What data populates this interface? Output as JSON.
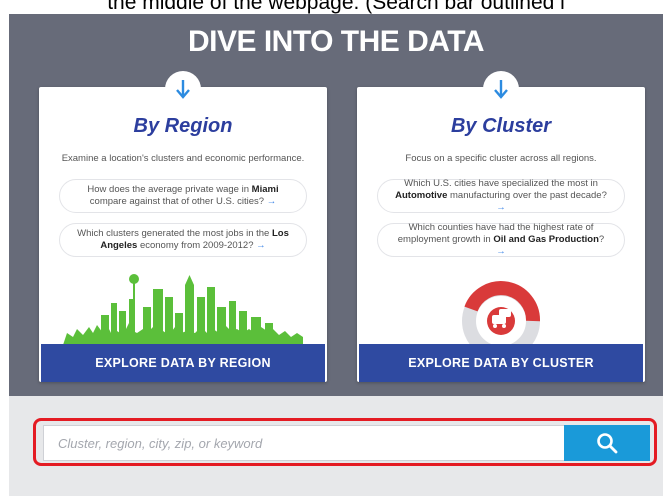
{
  "instruction": "the middle of the webpage. (Search bar outlined i",
  "hero": {
    "title": "DIVE INTO THE DATA"
  },
  "region": {
    "title": "By Region",
    "desc": "Examine a location's clusters and economic performance.",
    "q1": {
      "pre": "How does the average private wage in ",
      "bold": "Miami",
      "post": " compare against that of other U.S. cities? ",
      "arrow": "→"
    },
    "q2": {
      "pre": "Which clusters generated the most jobs in the ",
      "bold": "Los Angeles",
      "post": " economy from 2009-2012? ",
      "arrow": "→"
    },
    "button": "EXPLORE DATA BY REGION"
  },
  "cluster": {
    "title": "By Cluster",
    "desc": "Focus on a specific cluster across all regions.",
    "q1": {
      "pre": "Which U.S. cities have specialized the most in ",
      "bold": "Automotive",
      "post": " manufacturing over the past decade? ",
      "arrow": "→"
    },
    "q2": {
      "pre": "Which counties have had the highest rate of employment growth in ",
      "bold": "Oil and Gas Production",
      "post": "? ",
      "arrow": "→"
    },
    "button": "EXPLORE DATA BY CLUSTER"
  },
  "search": {
    "placeholder": "Cluster, region, city, zip, or keyword",
    "value": ""
  },
  "colors": {
    "hero_bg": "#676b79",
    "card_title": "#2c3e9e",
    "button": "#2f4aa1",
    "search_button": "#1a9ad9",
    "outline": "#e41b23",
    "skyline": "#5bbf3a",
    "donut": "#d93a3a"
  },
  "icons": {
    "badge": "down-arrow-icon",
    "search": "magnifier-icon",
    "region_art": "city-skyline-illustration",
    "cluster_art": "car-donut-illustration"
  }
}
